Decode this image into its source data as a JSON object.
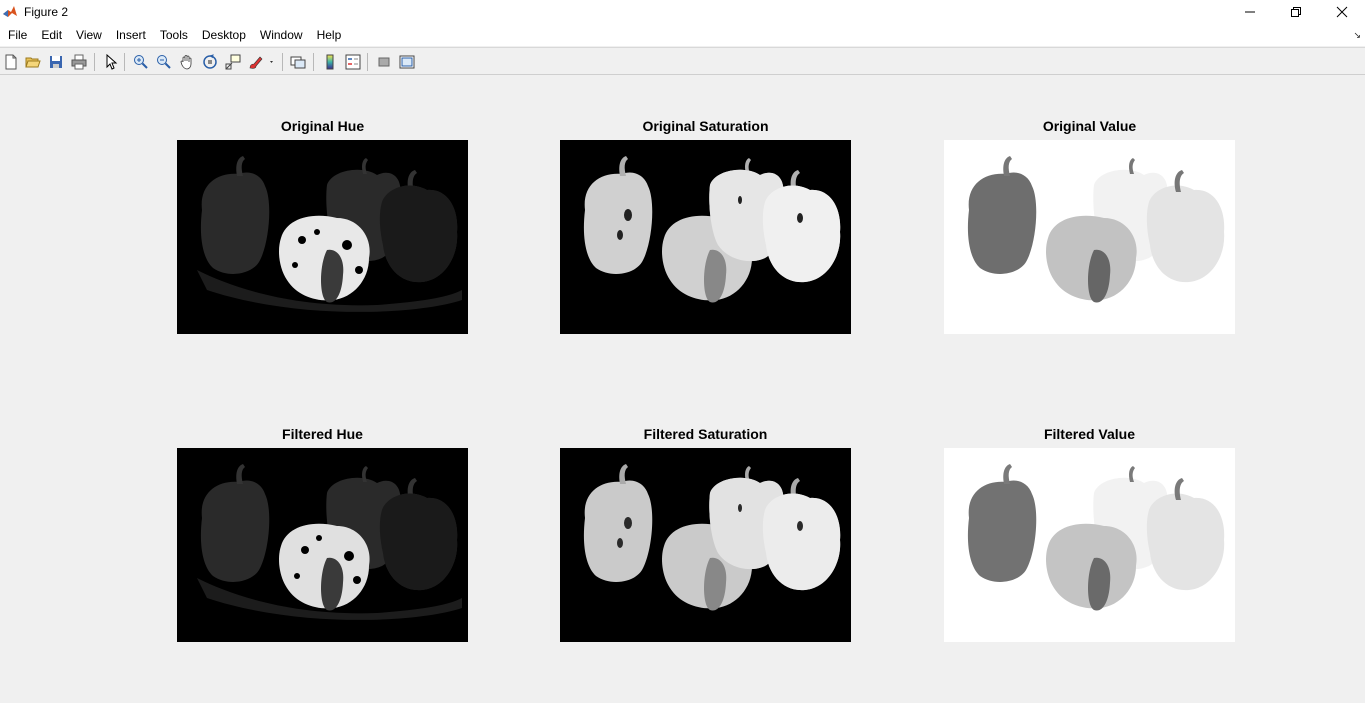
{
  "window": {
    "title": "Figure 2",
    "controls": [
      "minimize-icon",
      "restore-icon",
      "close-icon"
    ]
  },
  "menu": {
    "items": [
      "File",
      "Edit",
      "View",
      "Insert",
      "Tools",
      "Desktop",
      "Window",
      "Help"
    ]
  },
  "toolbar": {
    "buttons": [
      "new-figure-icon",
      "open-file-icon",
      "save-icon",
      "print-icon",
      "edit-plot-icon",
      "zoom-in-icon",
      "zoom-out-icon",
      "pan-icon",
      "rotate-3d-icon",
      "data-cursor-icon",
      "brush-icon",
      "link-plot-icon",
      "colorbar-icon",
      "legend-icon",
      "hide-plot-tools-icon",
      "show-plot-tools-icon"
    ]
  },
  "axes": [
    {
      "title": "Original Hue",
      "channel": "hue"
    },
    {
      "title": "Original Saturation",
      "channel": "saturation"
    },
    {
      "title": "Original Value",
      "channel": "value"
    },
    {
      "title": "Filtered Hue",
      "channel": "hue"
    },
    {
      "title": "Filtered Saturation",
      "channel": "saturation"
    },
    {
      "title": "Filtered Value",
      "channel": "value"
    }
  ],
  "colors": {
    "background": "#f0f0f0",
    "dark_image": "#000000",
    "light_image": "#ffffff"
  }
}
